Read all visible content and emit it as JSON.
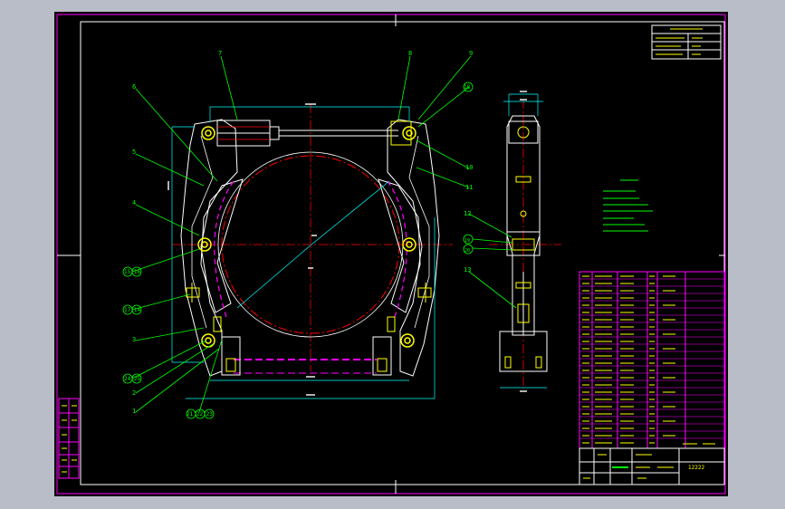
{
  "theme": {
    "background": "#b9bdc8",
    "sheet": "#000000",
    "border": "#ff00ff",
    "outline": "#ffffff",
    "part": "#ffff00",
    "centerline": "#ff0000",
    "leader": "#00ff00",
    "dimension": "#00ffff"
  },
  "callouts": {
    "n1": "1",
    "n2": "2",
    "n3": "3",
    "n4": "4",
    "n5": "5",
    "n6": "6",
    "n7": "7",
    "n8": "8",
    "n9": "9",
    "n10": "10",
    "n11": "11",
    "n12": "12",
    "n13": "13",
    "c18": "18",
    "c15_16": "15 16",
    "c17_14": "17 14",
    "c24_25": "24 25",
    "c21_22_23": "21 22 23",
    "c19": "19",
    "c20": "20"
  },
  "title_block": {
    "drawing_no": "12222"
  }
}
